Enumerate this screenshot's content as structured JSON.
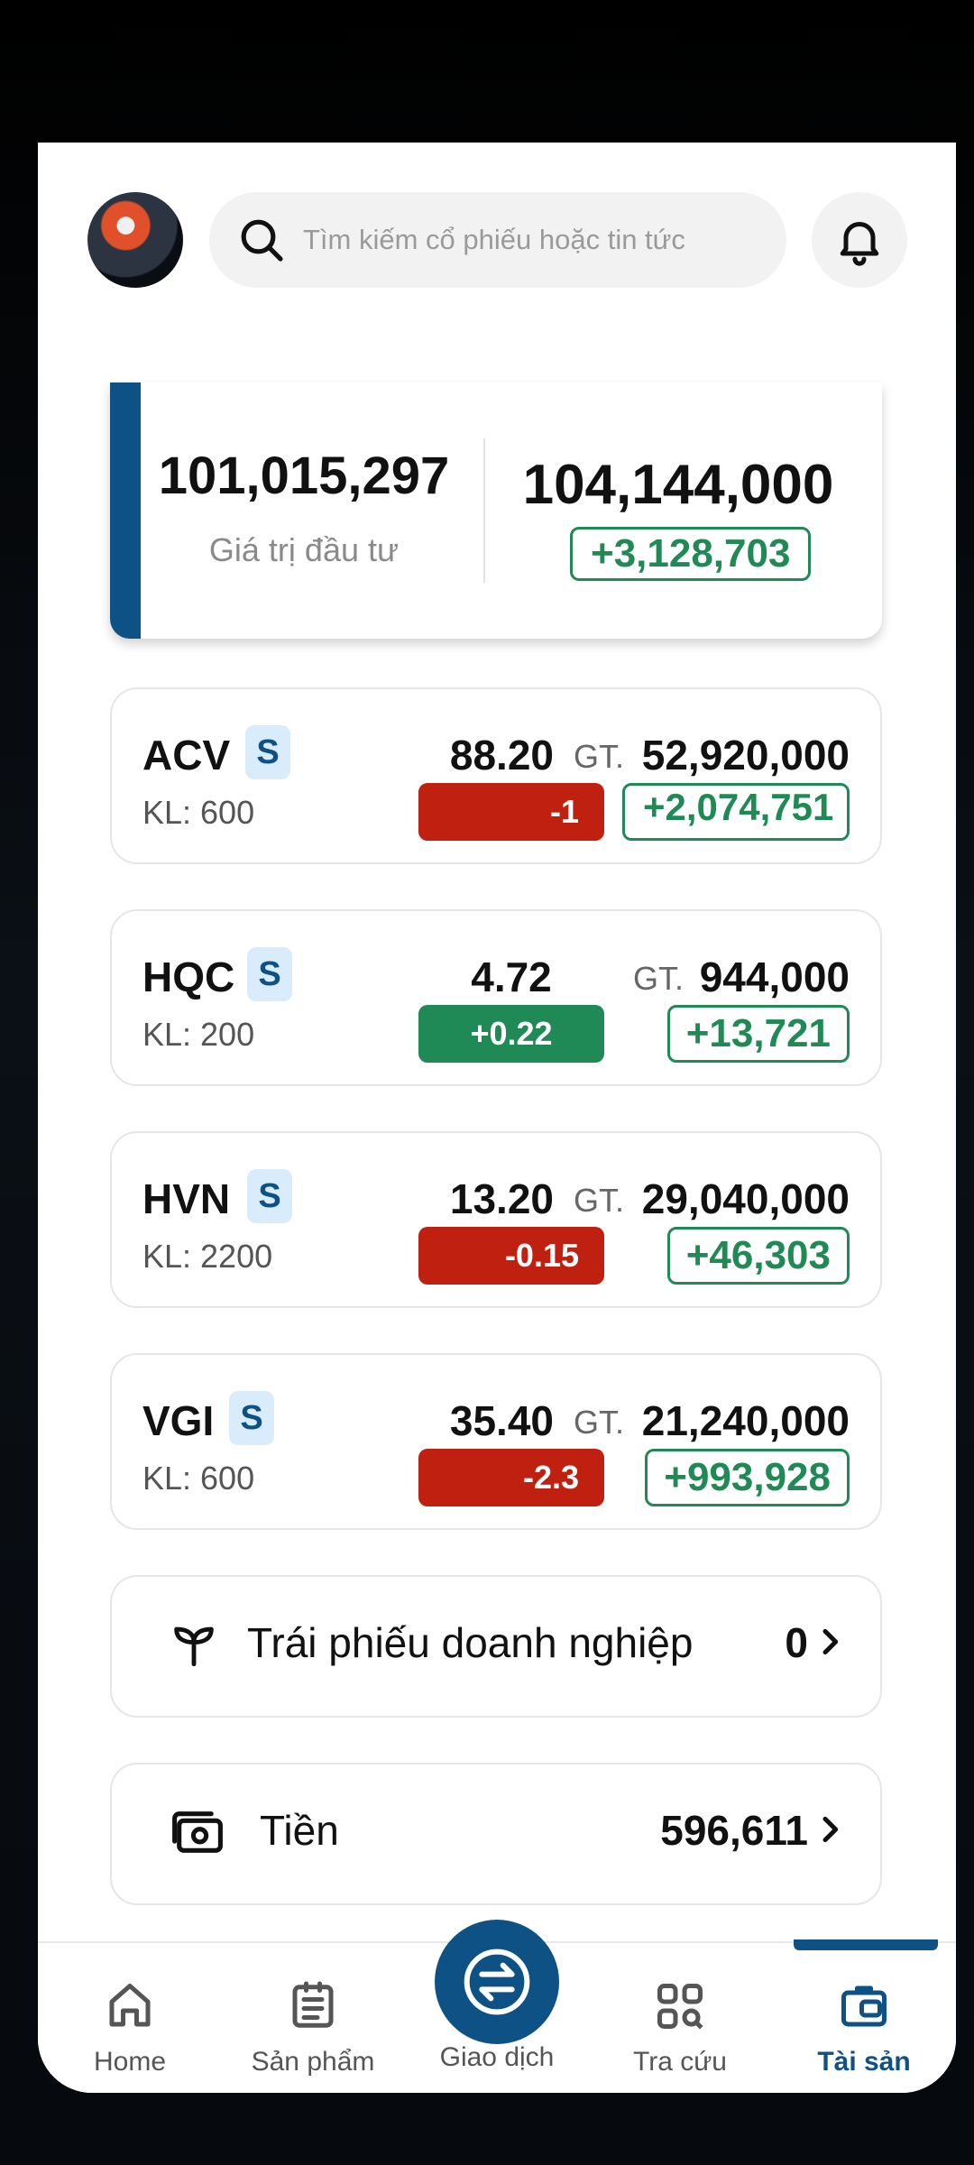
{
  "header": {
    "search_placeholder": "Tìm kiếm cổ phiếu hoặc tin tức"
  },
  "summary": {
    "investment_value": "101,015,297",
    "investment_label": "Giá trị đầu tư",
    "market_value": "104,144,000",
    "profit_loss": "+3,128,703"
  },
  "stocks": [
    {
      "symbol": "ACV",
      "badge": "S",
      "volume": "KL: 600",
      "price": "88.20",
      "change": "-1",
      "gt_label": "GT.",
      "gt_value": "52,920,000",
      "pnl": "+2,074,751",
      "direction": "down"
    },
    {
      "symbol": "HQC",
      "badge": "S",
      "volume": "KL: 200",
      "price": "4.72",
      "change": "+0.22",
      "gt_label": "GT.",
      "gt_value": "944,000",
      "pnl": "+13,721",
      "direction": "up"
    },
    {
      "symbol": "HVN",
      "badge": "S",
      "volume": "KL: 2200",
      "price": "13.20",
      "change": "-0.15",
      "gt_label": "GT.",
      "gt_value": "29,040,000",
      "pnl": "+46,303",
      "direction": "down"
    },
    {
      "symbol": "VGI",
      "badge": "S",
      "volume": "KL: 600",
      "price": "35.40",
      "change": "-2.3",
      "gt_label": "GT.",
      "gt_value": "21,240,000",
      "pnl": "+993,928",
      "direction": "down"
    }
  ],
  "bonds": {
    "label": "Trái phiếu doanh nghiệp",
    "value": "0",
    "icon": "sprout-icon"
  },
  "cash": {
    "label": "Tiền",
    "value": "596,611",
    "icon": "cash-icon"
  },
  "nav": {
    "items": [
      {
        "label": "Home",
        "icon": "home-icon"
      },
      {
        "label": "Sản phẩm",
        "icon": "product-icon"
      },
      {
        "label": "Giao dịch",
        "icon": "exchange-icon"
      },
      {
        "label": "Tra cứu",
        "icon": "lookup-icon"
      },
      {
        "label": "Tài sản",
        "icon": "wallet-icon"
      }
    ],
    "active": "Tài sản"
  },
  "colors": {
    "brand": "#0e5184",
    "up": "#1f8a55",
    "down": "#c0200f"
  }
}
